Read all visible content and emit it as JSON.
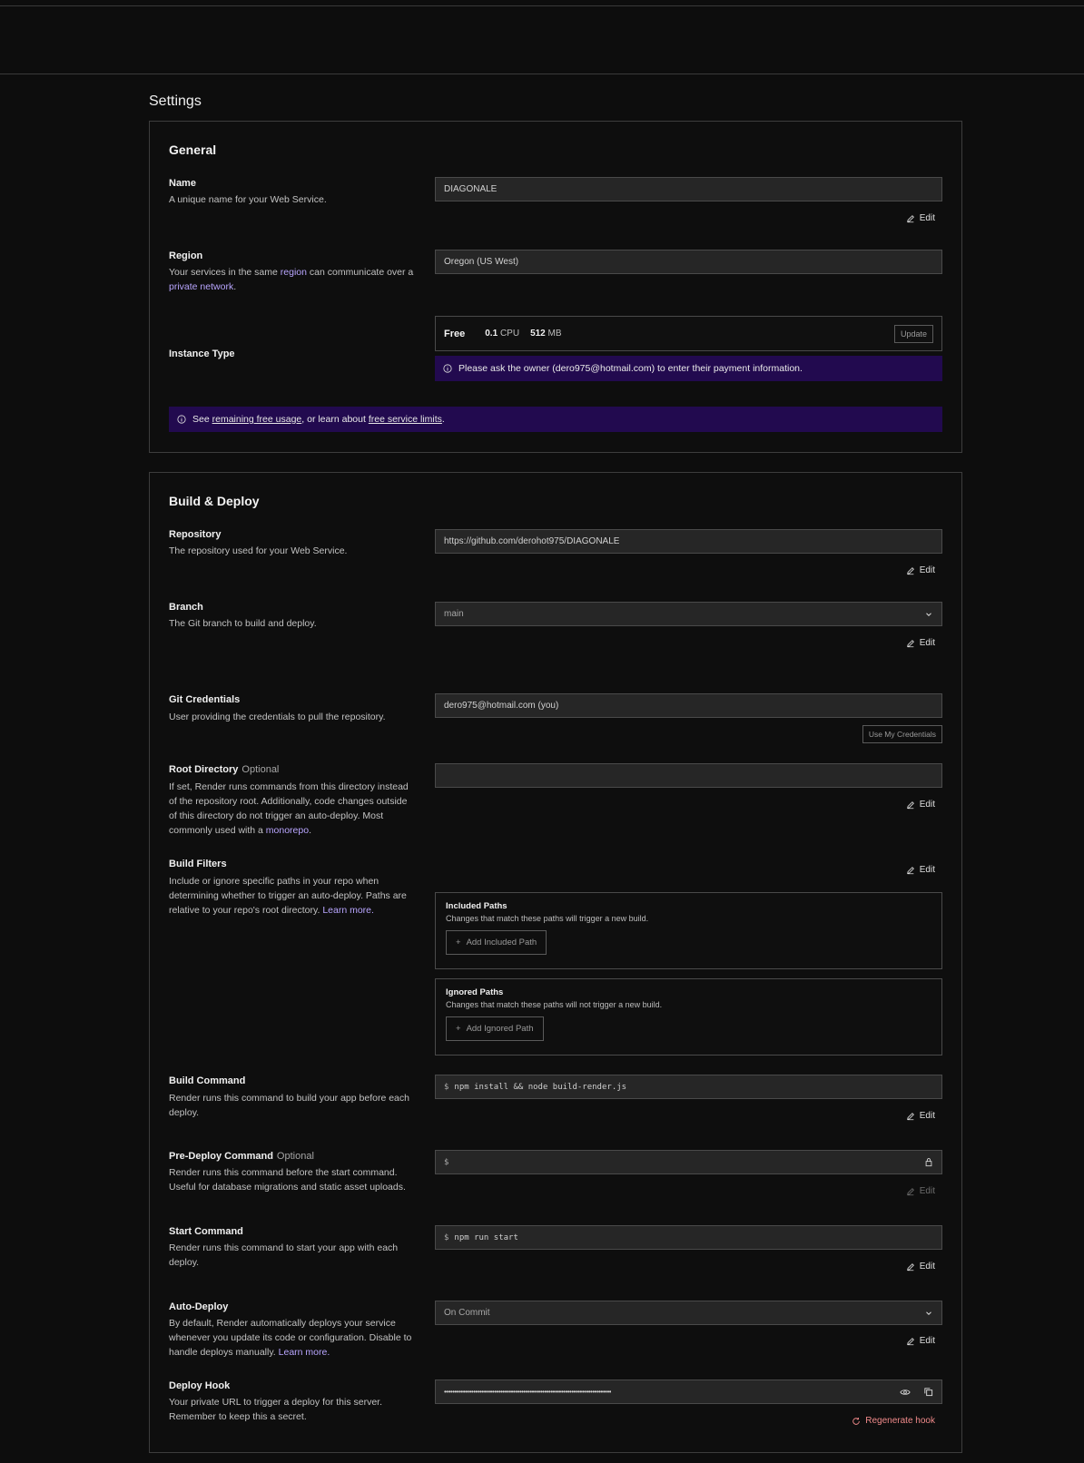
{
  "page": {
    "title": "Settings"
  },
  "general": {
    "title": "General",
    "name": {
      "label": "Name",
      "desc": "A unique name for your Web Service.",
      "value": "DIAGONALE",
      "edit": "Edit"
    },
    "region": {
      "label": "Region",
      "desc_pre": "Your services in the same ",
      "desc_link1": "region",
      "desc_mid": " can communicate over a ",
      "desc_link2": "private network",
      "desc_post": ".",
      "value": "Oregon (US West)"
    },
    "instance": {
      "label": "Instance Type",
      "tier": "Free",
      "cpu_value": "0.1",
      "cpu_unit": "CPU",
      "mem_value": "512",
      "mem_unit": "MB",
      "update": "Update",
      "notice": "Please ask the owner (dero975@hotmail.com) to enter their payment information."
    },
    "free_notice": {
      "pre": "See ",
      "link1": "remaining free usage",
      "mid": ", or learn about ",
      "link2": "free service limits",
      "post": "."
    }
  },
  "build": {
    "title": "Build & Deploy",
    "repo": {
      "label": "Repository",
      "desc": "The repository used for your Web Service.",
      "value": "https://github.com/derohot975/DIAGONALE",
      "edit": "Edit"
    },
    "branch": {
      "label": "Branch",
      "desc": "The Git branch to build and deploy.",
      "value": "main",
      "edit": "Edit"
    },
    "git_credentials": {
      "label": "Git Credentials",
      "desc": "User providing the credentials to pull the repository.",
      "value": "dero975@hotmail.com (you)",
      "button": "Use My Credentials"
    },
    "root_directory": {
      "label": "Root Directory",
      "optional": "Optional",
      "desc_pre": "If set, Render runs commands from this directory instead of the repository root. Additionally, code changes outside of this directory do not trigger an auto-deploy. Most commonly used with a ",
      "desc_link": "monorepo",
      "desc_post": ".",
      "value": "",
      "edit": "Edit"
    },
    "build_filters": {
      "label": "Build Filters",
      "desc_pre": "Include or ignore specific paths in your repo when determining whether to trigger an auto-deploy. Paths are relative to your repo's root directory. ",
      "desc_link": "Learn more.",
      "edit": "Edit",
      "included": {
        "title": "Included Paths",
        "desc": "Changes that match these paths will trigger a new build.",
        "button": "Add Included Path"
      },
      "ignored": {
        "title": "Ignored Paths",
        "desc": "Changes that match these paths will not trigger a new build.",
        "button": "Add Ignored Path"
      }
    },
    "build_command": {
      "label": "Build Command",
      "desc": "Render runs this command to build your app before each deploy.",
      "prompt": "$",
      "value": "npm install && node build-render.js",
      "edit": "Edit"
    },
    "pre_deploy": {
      "label": "Pre-Deploy Command",
      "optional": "Optional",
      "desc": "Render runs this command before the start command. Useful for database migrations and static asset uploads.",
      "prompt": "$",
      "value": "",
      "edit": "Edit"
    },
    "start_command": {
      "label": "Start Command",
      "desc": "Render runs this command to start your app with each deploy.",
      "prompt": "$",
      "value": "npm run start",
      "edit": "Edit"
    },
    "auto_deploy": {
      "label": "Auto-Deploy",
      "desc_pre": "By default, Render automatically deploys your service whenever you update its code or configuration. Disable to handle deploys manually. ",
      "desc_link": "Learn more.",
      "value": "On Commit",
      "edit": "Edit"
    },
    "deploy_hook": {
      "label": "Deploy Hook",
      "desc": "Your private URL to trigger a deploy for this server. Remember to keep this a secret.",
      "value": "••••••••••••••••••••••••••••••••••••••••••••••••••••••••••••••••••••••••••••••••",
      "regenerate": "Regenerate hook"
    }
  }
}
